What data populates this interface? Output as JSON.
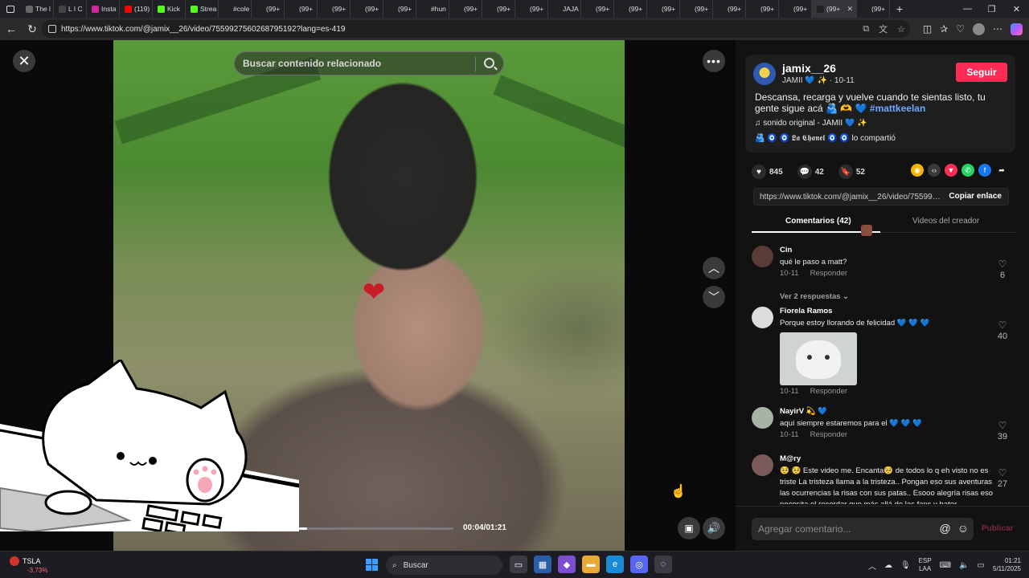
{
  "browser": {
    "tabs": [
      {
        "label": "The l",
        "color": "#666666"
      },
      {
        "label": "L I C",
        "color": "#444444"
      },
      {
        "label": "Insta",
        "color": "#d6249f"
      },
      {
        "label": "(119)",
        "color": "#ff0000"
      },
      {
        "label": "Kick",
        "color": "#53fc18"
      },
      {
        "label": "Strea",
        "color": "#53fc18"
      },
      {
        "label": "#cole",
        "color": "#222222"
      },
      {
        "label": "(99+",
        "color": "#222222"
      },
      {
        "label": "(99+",
        "color": "#222222"
      },
      {
        "label": "(99+",
        "color": "#222222"
      },
      {
        "label": "(99+",
        "color": "#222222"
      },
      {
        "label": "(99+",
        "color": "#222222"
      },
      {
        "label": "#hun",
        "color": "#222222"
      },
      {
        "label": "(99+",
        "color": "#222222"
      },
      {
        "label": "(99+",
        "color": "#222222"
      },
      {
        "label": "(99+",
        "color": "#222222"
      },
      {
        "label": "JAJA",
        "color": "#222222"
      },
      {
        "label": "(99+",
        "color": "#222222"
      },
      {
        "label": "(99+",
        "color": "#222222"
      },
      {
        "label": "(99+",
        "color": "#222222"
      },
      {
        "label": "(99+",
        "color": "#222222"
      },
      {
        "label": "(99+",
        "color": "#222222"
      },
      {
        "label": "(99+",
        "color": "#222222"
      },
      {
        "label": "(99+",
        "color": "#222222"
      },
      {
        "label": "(99+",
        "color": "#222222"
      }
    ],
    "active_tab": "(99+",
    "url": "https://www.tiktok.com/@jamix__26/video/7559927560268795192?lang=es-419"
  },
  "video": {
    "search_placeholder": "Buscar contenido relacionado",
    "time": "00:04/01:21",
    "progress": 0.05
  },
  "creator": {
    "username": "jamix__26",
    "subline": "JAMII 💙 ✨ · 10-11",
    "follow_label": "Seguir",
    "description_text": "Descansa, recarga y vuelve cuando te sientas listo, tu gente sigue acá 🫂 🫶 💙 ",
    "hashtag": "#mattkeelan",
    "sound": "♫  sonido original - JAMII 💙 ✨",
    "shared_by": "🫂 🧿 🧿 𝕷𝖆 𝕮𝖍𝖆𝖓𝖊𝖑 🧿 🧿 lo compartió"
  },
  "stats": {
    "likes": "845",
    "comments": "42",
    "saves": "52"
  },
  "share_icon_colors": [
    "#f4b400",
    "#3a3a3a",
    "#fe2c55",
    "#25d366",
    "#1877f2",
    "#121212"
  ],
  "link": {
    "url": "https://www.tiktok.com/@jamix__26/video/7559927560268795192",
    "copy_label": "Copiar enlace"
  },
  "panel_tabs": {
    "comments": "Comentarios (42)",
    "creator_videos": "Videos del creador"
  },
  "comments": [
    {
      "name": "Cin",
      "text": "qué le paso a matt?",
      "date": "10-11",
      "reply": "Responder",
      "likes": "6",
      "replies": "Ver 2 respuestas ⌄",
      "avatar": "#5a3b35"
    },
    {
      "name": "Fiorela Ramos",
      "text": "Porque estoy llorando de felicidad 💙 💙 💙",
      "date": "10-11",
      "reply": "Responder",
      "likes": "40",
      "avatar": "#dcdcdc"
    },
    {
      "name": "NayirV 💫 💙",
      "text": "aquí siempre estaremos para el 💙 💙 💙",
      "date": "10-11",
      "reply": "Responder",
      "likes": "39",
      "avatar": "#a8b3a8"
    },
    {
      "name": "M@ry",
      "text": "🥺 🥺 Este video me. Encanta🥺 de todos lo q eh visto no es triste La tristeza llama a la tristeza.. Pongan eso sus aventuras las ocurrencias la risas con sus patas.. Esooo alegría risas eso necesita el recordar que más allá de las fans y hater",
      "likes": "27",
      "avatar": "#7a5a5a"
    }
  ],
  "comment_input": {
    "placeholder": "Agregar comentario...",
    "publish": "Publicar"
  },
  "taskbar": {
    "ticker_name": "TSLA",
    "ticker_change": "-3.73%",
    "search": "Buscar",
    "lang1": "ESP",
    "lang2": "LAA",
    "time": "01:21",
    "date": "5/11/2025"
  }
}
